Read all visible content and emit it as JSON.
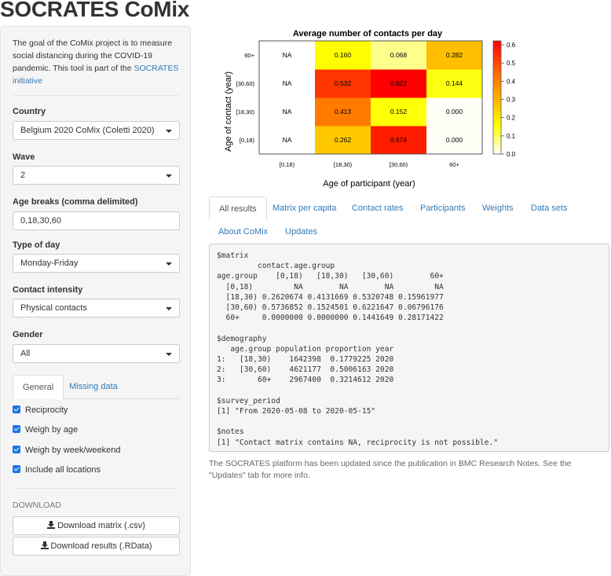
{
  "app_title": "SOCRATES CoMix",
  "sidebar": {
    "intro_text": "The goal of the CoMix project is to measure social distancing during the COVID-19 pandemic. This tool is part of the ",
    "intro_link": "SOCRATES initiative",
    "country": {
      "label": "Country",
      "value": "Belgium 2020 CoMix (Coletti 2020)"
    },
    "wave": {
      "label": "Wave",
      "value": "2"
    },
    "age_breaks": {
      "label": "Age breaks (comma delimited)",
      "value": "0,18,30,60"
    },
    "type_of_day": {
      "label": "Type of day",
      "value": "Monday-Friday"
    },
    "contact_intensity": {
      "label": "Contact intensity",
      "value": "Physical contacts"
    },
    "gender": {
      "label": "Gender",
      "value": "All"
    },
    "tabs": [
      {
        "label": "General",
        "active": true
      },
      {
        "label": "Missing data",
        "active": false
      }
    ],
    "checkboxes": [
      {
        "label": "Reciprocity",
        "checked": true
      },
      {
        "label": "Weigh by age",
        "checked": true
      },
      {
        "label": "Weigh by week/weekend",
        "checked": true
      },
      {
        "label": "Include all locations",
        "checked": true
      }
    ],
    "download_heading": "DOWNLOAD",
    "download_buttons": [
      {
        "label": "Download matrix (.csv)",
        "icon": "download-icon"
      },
      {
        "label": "Download results (.RData)",
        "icon": "download-icon"
      }
    ]
  },
  "chart_data": {
    "type": "heatmap",
    "title": "Average number of contacts per day",
    "xlabel": "Age of participant (year)",
    "ylabel": "Age of contact (year)",
    "x_categories": [
      "[0,18)",
      "[18,30)",
      "[30,60)",
      "60+"
    ],
    "y_categories": [
      "[0,18)",
      "[18,30)",
      "[30,60)",
      "60+"
    ],
    "values": [
      [
        null,
        0.262,
        0.574,
        0.0
      ],
      [
        null,
        0.413,
        0.152,
        0.0
      ],
      [
        null,
        0.532,
        0.622,
        0.144
      ],
      [
        null,
        0.16,
        0.068,
        0.282
      ]
    ],
    "value_labels": [
      [
        "NA",
        "0.262",
        "0.574",
        "0.000"
      ],
      [
        "NA",
        "0.413",
        "0.152",
        "0.000"
      ],
      [
        "NA",
        "0.532",
        "0.622",
        "0.144"
      ],
      [
        "NA",
        "0.160",
        "0.068",
        "0.282"
      ]
    ],
    "colorbar": {
      "range": [
        0.0,
        0.622
      ],
      "ticks": [
        "0.0",
        "0.1",
        "0.2",
        "0.3",
        "0.4",
        "0.5",
        "0.6"
      ],
      "palette": "heat (white-yellow-red)"
    },
    "legend": "right"
  },
  "main": {
    "tabs": [
      {
        "label": "All results",
        "active": true
      },
      {
        "label": "Matrix per capita",
        "active": false
      },
      {
        "label": "Contact rates",
        "active": false
      },
      {
        "label": "Participants",
        "active": false
      },
      {
        "label": "Weights",
        "active": false
      },
      {
        "label": "Data sets",
        "active": false
      },
      {
        "label": "About CoMix",
        "active": false
      },
      {
        "label": "Updates",
        "active": false
      }
    ],
    "output": "$matrix\n         contact.age.group\nage.group    [0,18)   [18,30)   [30,60)        60+\n  [0,18)         NA        NA        NA         NA\n  [18,30) 0.2620674 0.4131669 0.5320748 0.15961977\n  [30,60) 0.5736852 0.1524501 0.6221647 0.06796176\n  60+     0.0000000 0.0000000 0.1441649 0.28171422\n\n$demography\n   age.group population proportion year\n1:   [18,30)    1642398  0.1779225 2020\n2:   [30,60)    4621177  0.5006163 2020\n3:       60+    2967400  0.3214612 2020\n\n$survey_period\n[1] \"From 2020-05-08 to 2020-05-15\"\n\n$notes\n[1] \"Contact matrix contains NA, reciprocity is not possible.\"",
    "footnote": "The SOCRATES platform has been updated since the publication in BMC Research Notes. See the \"Updates\" tab for more info."
  }
}
